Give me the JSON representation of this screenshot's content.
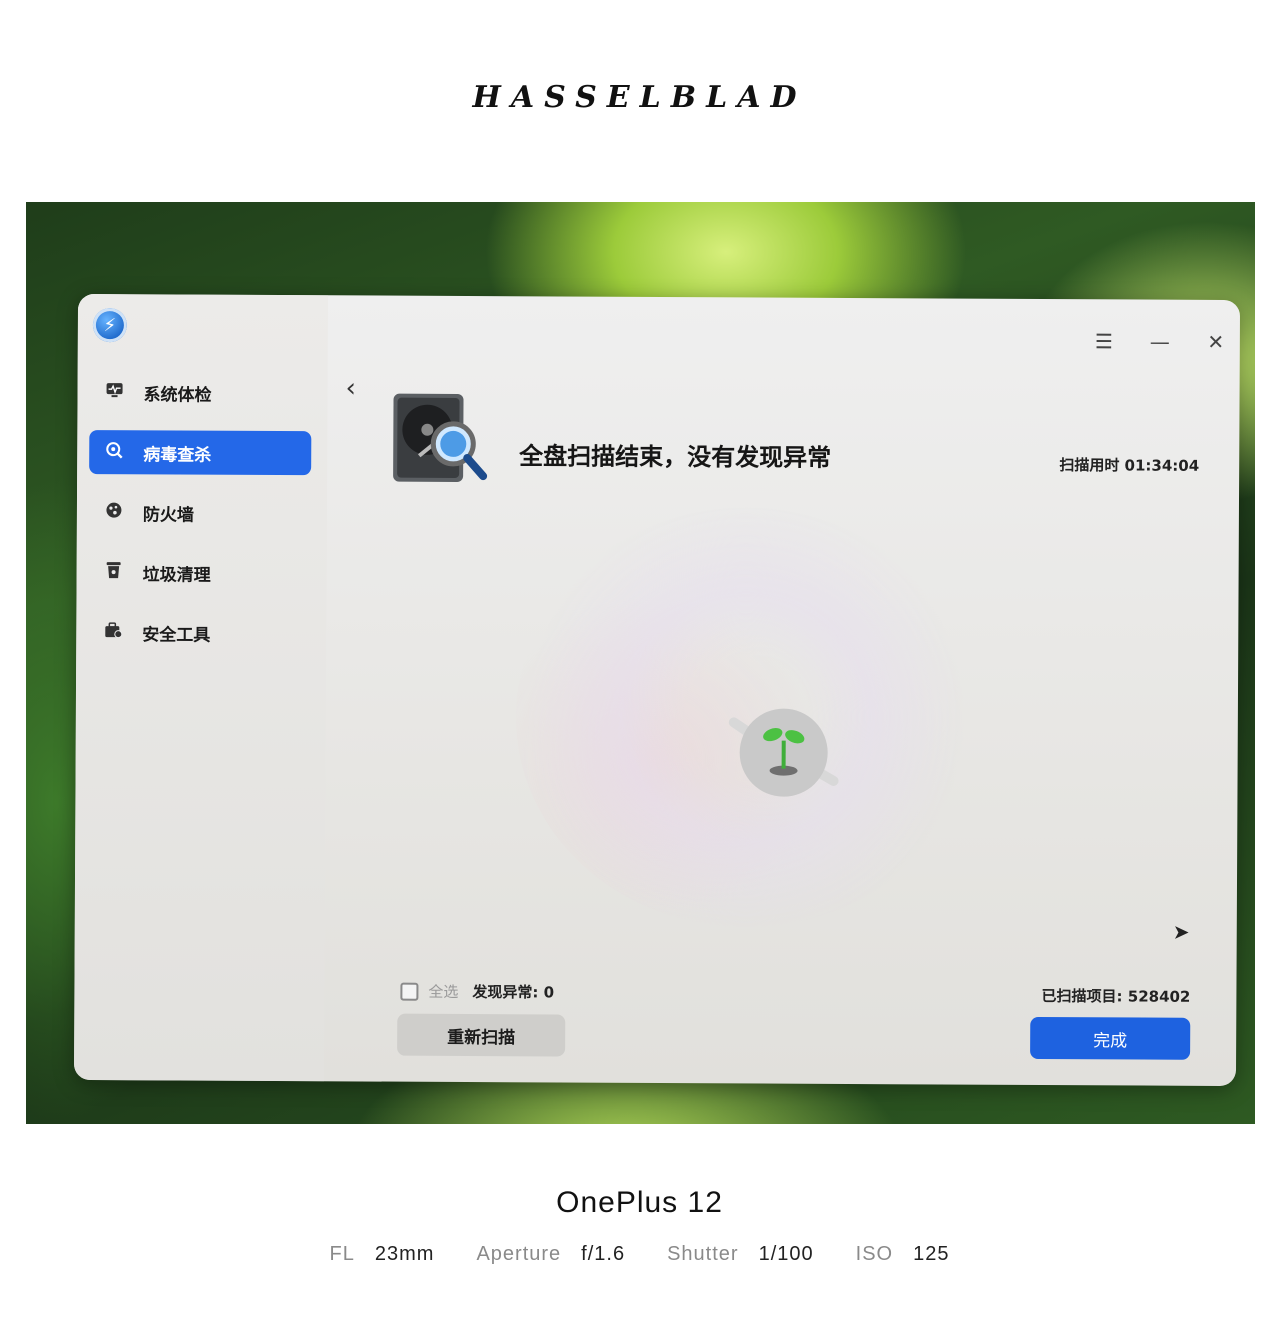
{
  "brand": "HASSELBLAD",
  "window": {
    "title_buttons": {
      "menu": "☰",
      "minimize": "—",
      "close": "✕"
    },
    "sidebar": {
      "items": [
        {
          "label": "系统体检",
          "icon": "monitor-pulse-icon",
          "active": false
        },
        {
          "label": "病毒查杀",
          "icon": "virus-scan-icon",
          "active": true
        },
        {
          "label": "防火墙",
          "icon": "firewall-icon",
          "active": false
        },
        {
          "label": "垃圾清理",
          "icon": "trash-bin-icon",
          "active": false
        },
        {
          "label": "安全工具",
          "icon": "toolbox-icon",
          "active": false
        }
      ]
    },
    "main": {
      "headline": "全盘扫描结束，没有发现异常",
      "scan_time": "扫描用时 01:34:04",
      "select_all": "全选",
      "found": "发现异常: 0",
      "rescan_button": "重新扫描",
      "scanned": "已扫描项目: 528402",
      "done_button": "完成"
    },
    "accent_color": "#2468e8"
  },
  "footer": {
    "device": "OnePlus 12",
    "exif": [
      {
        "key": "FL",
        "value": "23mm"
      },
      {
        "key": "Aperture",
        "value": "f/1.6"
      },
      {
        "key": "Shutter",
        "value": "1/100"
      },
      {
        "key": "ISO",
        "value": "125"
      }
    ]
  }
}
